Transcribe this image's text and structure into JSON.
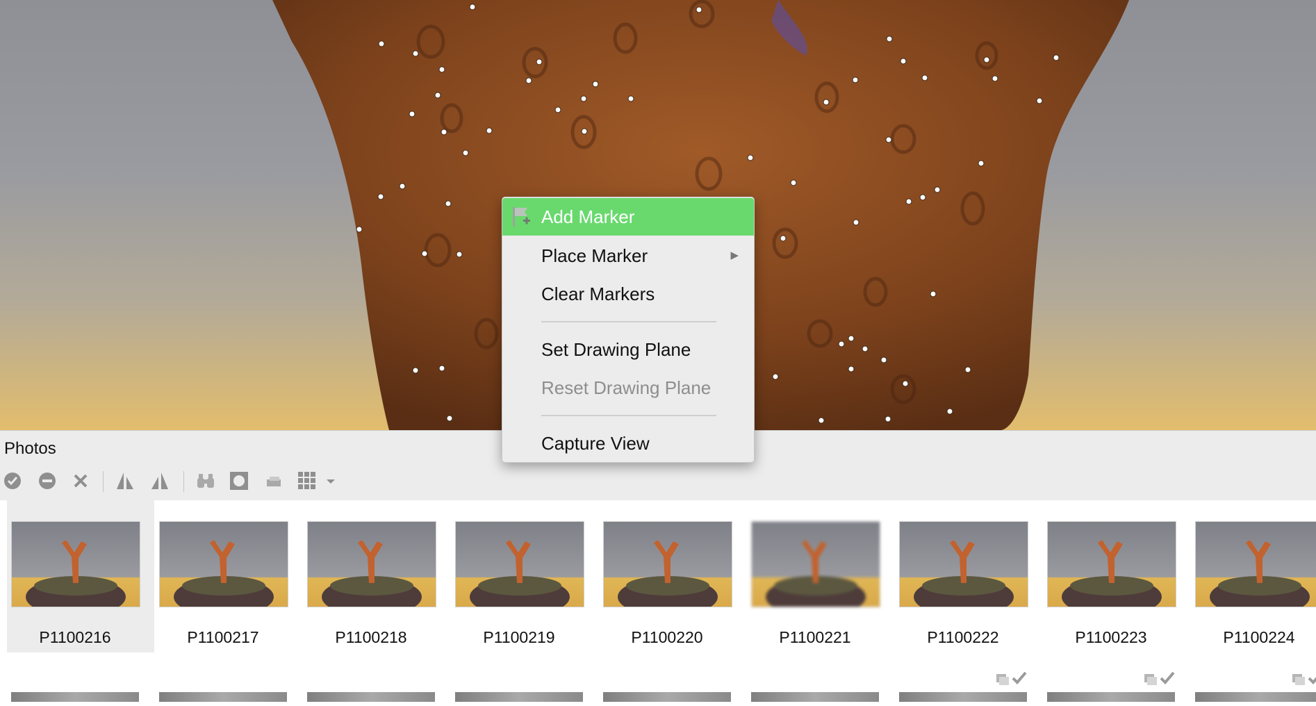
{
  "context_menu": {
    "items": [
      {
        "label": "Add Marker",
        "state": "highlighted",
        "icon": "add-marker-flag-icon"
      },
      {
        "label": "Place Marker",
        "state": "normal",
        "submenu": true
      },
      {
        "label": "Clear Markers",
        "state": "normal"
      },
      {
        "label": "Set Drawing Plane",
        "state": "normal"
      },
      {
        "label": "Reset Drawing Plane",
        "state": "disabled"
      },
      {
        "label": "Capture View",
        "state": "normal"
      }
    ],
    "highlight_color": "#69d96e"
  },
  "photos": {
    "title": "Photos",
    "toolbar": {
      "icons": [
        "enable-icon",
        "disable-icon",
        "remove-icon",
        "align-left-icon",
        "align-right-icon",
        "binoculars-icon",
        "mask-icon",
        "layer-icon",
        "grid-view-icon",
        "dropdown-icon"
      ]
    },
    "thumbnails": [
      {
        "label": "P1100216",
        "selected": true
      },
      {
        "label": "P1100217",
        "selected": false
      },
      {
        "label": "P1100218",
        "selected": false
      },
      {
        "label": "P1100219",
        "selected": false
      },
      {
        "label": "P1100220",
        "selected": false
      },
      {
        "label": "P1100221",
        "selected": false
      },
      {
        "label": "P1100222",
        "selected": false
      },
      {
        "label": "P1100223",
        "selected": false
      },
      {
        "label": "P1100224",
        "selected": false
      }
    ]
  },
  "colors": {
    "menu_background": "#ececec",
    "pane_header": "#ececec",
    "coral": "#8a4a1e",
    "rock": "#4a3a36"
  }
}
